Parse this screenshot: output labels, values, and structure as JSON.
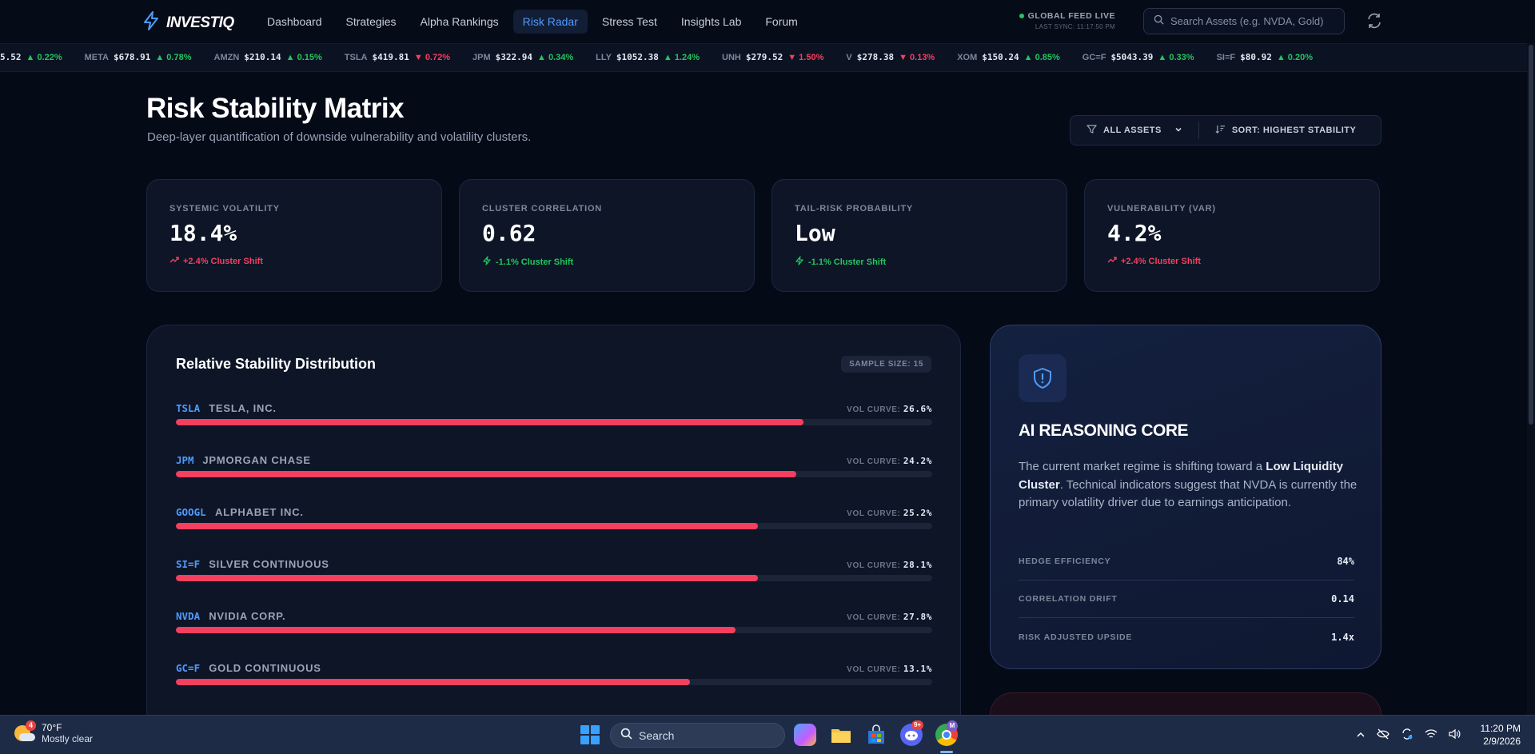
{
  "app": {
    "name": "INVESTIQ"
  },
  "nav": {
    "links": [
      "Dashboard",
      "Strategies",
      "Alpha Rankings",
      "Risk Radar",
      "Stress Test",
      "Insights Lab",
      "Forum"
    ],
    "active": "Risk Radar"
  },
  "feed": {
    "status": "GLOBAL FEED LIVE",
    "last_sync": "LAST SYNC: 11:17:50 PM"
  },
  "search": {
    "placeholder": "Search Assets (e.g. NVDA, Gold)"
  },
  "ticker": [
    {
      "sym": "",
      "price": "5.52",
      "change": "▲ 0.22%",
      "dir": "up"
    },
    {
      "sym": "META",
      "price": "$678.91",
      "change": "▲ 0.78%",
      "dir": "up"
    },
    {
      "sym": "AMZN",
      "price": "$210.14",
      "change": "▲ 0.15%",
      "dir": "up"
    },
    {
      "sym": "TSLA",
      "price": "$419.81",
      "change": "▼ 0.72%",
      "dir": "down"
    },
    {
      "sym": "JPM",
      "price": "$322.94",
      "change": "▲ 0.34%",
      "dir": "up"
    },
    {
      "sym": "LLY",
      "price": "$1052.38",
      "change": "▲ 1.24%",
      "dir": "up"
    },
    {
      "sym": "UNH",
      "price": "$279.52",
      "change": "▼ 1.50%",
      "dir": "down"
    },
    {
      "sym": "V",
      "price": "$278.38",
      "change": "▼ 0.13%",
      "dir": "down"
    },
    {
      "sym": "XOM",
      "price": "$150.24",
      "change": "▲ 0.85%",
      "dir": "up"
    },
    {
      "sym": "GC=F",
      "price": "$5043.39",
      "change": "▲ 0.33%",
      "dir": "up"
    },
    {
      "sym": "SI=F",
      "price": "$80.92",
      "change": "▲ 0.20%",
      "dir": "up"
    }
  ],
  "header": {
    "title": "Risk Stability Matrix",
    "subtitle": "Deep-layer quantification of downside vulnerability and volatility clusters.",
    "filter_label": "ALL ASSETS",
    "sort_label": "SORT: HIGHEST STABILITY"
  },
  "kpis": [
    {
      "label": "SYSTEMIC VOLATILITY",
      "value": "18.4%",
      "delta": "+2.4% Cluster Shift",
      "tone": "bad"
    },
    {
      "label": "CLUSTER CORRELATION",
      "value": "0.62",
      "delta": "-1.1% Cluster Shift",
      "tone": "good"
    },
    {
      "label": "TAIL-RISK PROBABILITY",
      "value": "Low",
      "delta": "-1.1% Cluster Shift",
      "tone": "good"
    },
    {
      "label": "VULNERABILITY (VAR)",
      "value": "4.2%",
      "delta": "+2.4% Cluster Shift",
      "tone": "bad"
    }
  ],
  "stability": {
    "title": "Relative Stability Distribution",
    "sample": "SAMPLE SIZE: 15",
    "vol_label": "VOL CURVE:",
    "rows": [
      {
        "sym": "TSLA",
        "name": "TESLA, INC.",
        "vol": "26.6%",
        "stability_fill": 0.83
      },
      {
        "sym": "JPM",
        "name": "JPMORGAN CHASE",
        "vol": "24.2%",
        "stability_fill": 0.82
      },
      {
        "sym": "GOOGL",
        "name": "ALPHABET INC.",
        "vol": "25.2%",
        "stability_fill": 0.77
      },
      {
        "sym": "SI=F",
        "name": "SILVER CONTINUOUS",
        "vol": "28.1%",
        "stability_fill": 0.77
      },
      {
        "sym": "NVDA",
        "name": "NVIDIA CORP.",
        "vol": "27.8%",
        "stability_fill": 0.74
      },
      {
        "sym": "GC=F",
        "name": "GOLD CONTINUOUS",
        "vol": "13.1%",
        "stability_fill": 0.68
      }
    ]
  },
  "ai": {
    "title": "AI REASONING CORE",
    "text_a": "The current market regime is shifting toward a ",
    "text_b": "Low Liquidity Cluster",
    "text_c": ". Technical indicators suggest that NVDA is currently the primary volatility driver due to earnings anticipation.",
    "metrics": [
      {
        "label": "HEDGE EFFICIENCY",
        "value": "84%"
      },
      {
        "label": "CORRELATION DRIFT",
        "value": "0.14"
      },
      {
        "label": "RISK ADJUSTED UPSIDE",
        "value": "1.4x"
      }
    ]
  },
  "taskbar": {
    "weather_temp": "70°F",
    "weather_desc": "Mostly clear",
    "weather_badge": "4",
    "search_label": "Search",
    "discord_badge": "9+",
    "chrome_badge": "M",
    "time": "11:20 PM",
    "date": "2/9/2026"
  },
  "colors": {
    "accent": "#4f9bff",
    "danger": "#f43f5e",
    "positive": "#22c55e",
    "background": "#050a17"
  }
}
